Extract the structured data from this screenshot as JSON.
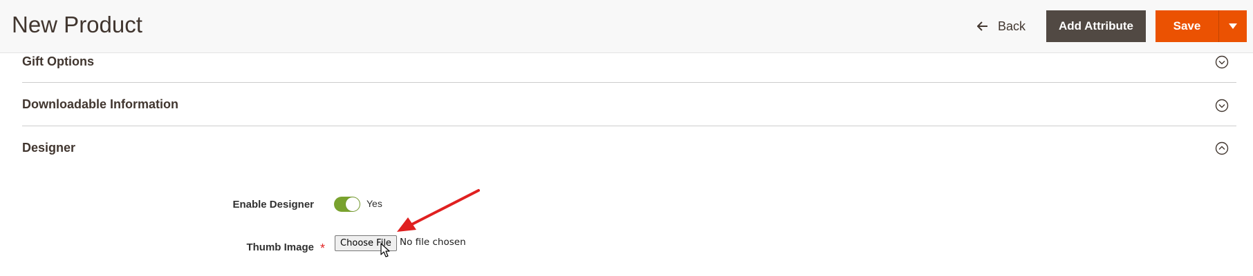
{
  "header": {
    "title": "New Product",
    "back_label": "Back",
    "add_attribute_label": "Add Attribute",
    "save_label": "Save"
  },
  "sections": [
    {
      "title": "Gift Options",
      "state": "collapsed"
    },
    {
      "title": "Downloadable Information",
      "state": "collapsed"
    },
    {
      "title": "Designer",
      "state": "expanded"
    }
  ],
  "designer": {
    "enable_label": "Enable Designer",
    "enable_value": "Yes",
    "enabled": true,
    "thumb_label": "Thumb Image",
    "thumb_required": "*",
    "choose_file_label": "Choose File",
    "no_file_text": "No file chosen"
  },
  "colors": {
    "save": "#eb5202",
    "add_attribute": "#514943",
    "switch_on": "#79a22e",
    "annotation_arrow": "#e02020"
  },
  "icons": {
    "back": "arrow-left-icon",
    "save_menu": "caret-down-icon",
    "collapsed": "chevron-down-circle-icon",
    "expanded": "chevron-up-circle-icon"
  }
}
